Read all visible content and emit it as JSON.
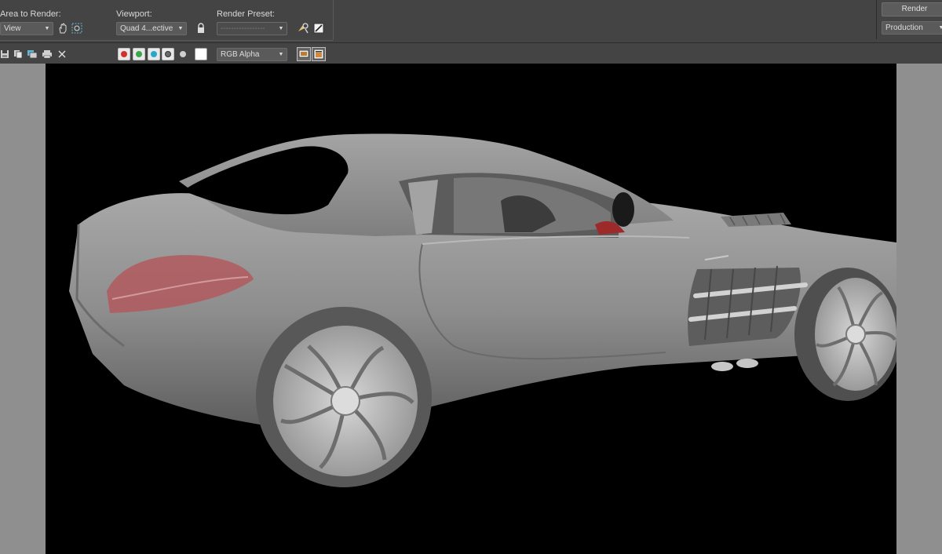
{
  "top": {
    "area_label": "Area to Render:",
    "area_value": "View",
    "viewport_label": "Viewport:",
    "viewport_value": "Quad 4...ective",
    "preset_label": "Render Preset:",
    "preset_value": "-----------------",
    "render_button": "Render",
    "render_mode": "Production"
  },
  "toolbar": {
    "channel_value": "RGB Alpha",
    "channel_colors": {
      "red": "#d03030",
      "green": "#3aa84a",
      "blue": "#2aa6c8",
      "alpha": "#8a8a8a",
      "mono": "#cfcfcf",
      "swatch": "#ffffff"
    }
  },
  "viewport": {
    "background": "#000000",
    "side_gutter": "#8f8f8f",
    "car_color": "#8e8e8e",
    "taillight_color": "#b25a5e"
  }
}
